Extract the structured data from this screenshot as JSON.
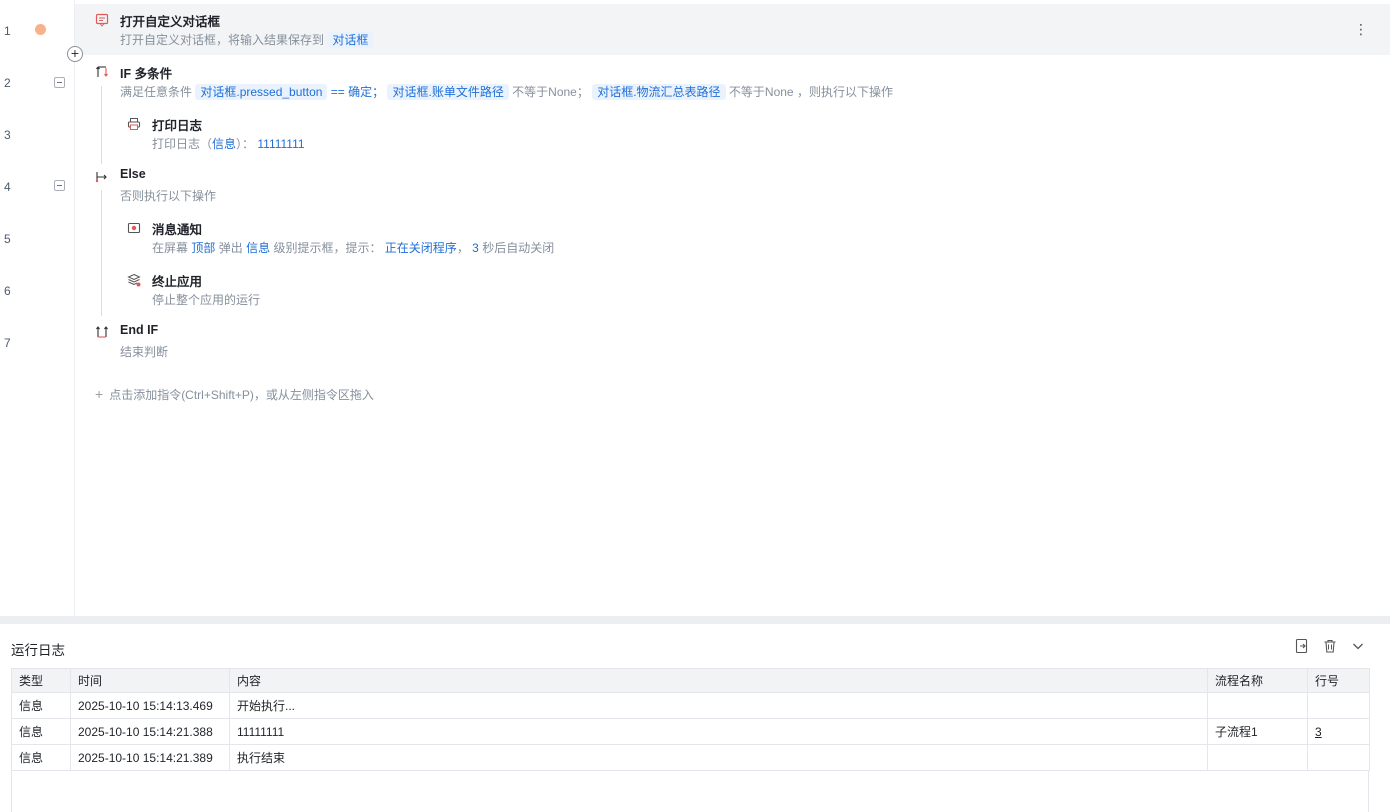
{
  "editor": {
    "line_numbers": [
      "1",
      "2",
      "3",
      "4",
      "5",
      "6",
      "7"
    ],
    "steps": {
      "open_dialog": {
        "title": "打开自定义对话框",
        "desc_prefix": "打开自定义对话框，将输入结果保存到",
        "var": "对话框"
      },
      "if_multi": {
        "title": "IF 多条件",
        "desc_prefix": "满足任意条件",
        "cond1_var": "对话框.pressed_button",
        "cond1_op": "== 确定；",
        "cond2_var": "对话框.账单文件路径",
        "cond2_op": "不等于None；",
        "cond3_var": "对话框.物流汇总表路径",
        "cond3_op": "不等于None",
        "desc_suffix": "，则执行以下操作"
      },
      "print_log": {
        "title": "打印日志",
        "desc_prefix": "打印日志（",
        "level": "信息",
        "desc_mid": "）：",
        "value": "11111111"
      },
      "else": {
        "title": "Else",
        "desc": "否则执行以下操作"
      },
      "notify": {
        "title": "消息通知",
        "desc_p1": "在屏幕",
        "position": "顶部",
        "desc_p2": "弹出",
        "level": "信息",
        "desc_p3": "级别提示框，提示：",
        "message": "正在关闭程序",
        "desc_p4": "，",
        "seconds": "3",
        "desc_p5": "秒后自动关闭"
      },
      "terminate": {
        "title": "终止应用",
        "desc": "停止整个应用的运行"
      },
      "end_if": {
        "title": "End IF",
        "desc": "结束判断"
      }
    },
    "add_hint": "点击添加指令(Ctrl+Shift+P)，或从左侧指令区拖入",
    "colors": {
      "accent": "#1f6fd6",
      "breakpoint": "#f7b18b",
      "icon_red": "#e05a5a"
    }
  },
  "log": {
    "title": "运行日志",
    "columns": [
      "类型",
      "时间",
      "内容",
      "流程名称",
      "行号"
    ],
    "rows": [
      {
        "type": "信息",
        "time": "2025-10-10 15:14:13.469",
        "content": "开始执行...",
        "flow": "",
        "line": ""
      },
      {
        "type": "信息",
        "time": "2025-10-10 15:14:21.388",
        "content": "11111111",
        "flow": "子流程1",
        "line": "3"
      },
      {
        "type": "信息",
        "time": "2025-10-10 15:14:21.389",
        "content": "执行结束",
        "flow": "",
        "line": ""
      }
    ]
  }
}
